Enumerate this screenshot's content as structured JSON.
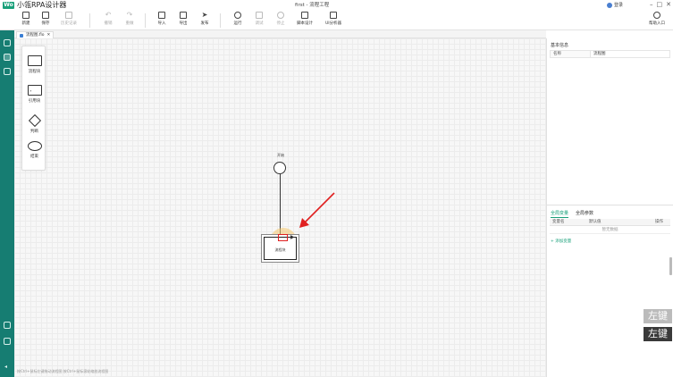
{
  "app": {
    "logo": "Wo",
    "title": "小瓴RPA设计器"
  },
  "window": {
    "doc_title": "first - 流程工程",
    "login": "登录",
    "min": "–",
    "max": "□",
    "close": "✕"
  },
  "toolbar": [
    {
      "label": "新建",
      "icon": "new-icon",
      "disabled": false
    },
    {
      "label": "保存",
      "icon": "save-icon",
      "disabled": false
    },
    {
      "label": "历史记录",
      "icon": "history-icon",
      "disabled": true
    },
    {
      "label": "撤销",
      "icon": "undo-icon",
      "disabled": true
    },
    {
      "label": "重做",
      "icon": "redo-icon",
      "disabled": true
    },
    {
      "label": "导入",
      "icon": "import-icon",
      "disabled": false
    },
    {
      "label": "导出",
      "icon": "export-icon",
      "disabled": false
    },
    {
      "label": "发布",
      "icon": "publish-icon",
      "disabled": false
    },
    {
      "label": "运行",
      "icon": "run-icon",
      "disabled": false
    },
    {
      "label": "调试",
      "icon": "debug-icon",
      "disabled": true
    },
    {
      "label": "停止",
      "icon": "stop-icon",
      "disabled": true
    },
    {
      "label": "脚本设计",
      "icon": "script-icon",
      "disabled": false
    },
    {
      "label": "UI分析器",
      "icon": "ui-analyzer-icon",
      "disabled": false
    },
    {
      "label": "帮助入口",
      "icon": "help-icon",
      "disabled": false
    }
  ],
  "tab": {
    "label": "流程图.flo",
    "close": "✕"
  },
  "palette": [
    {
      "label": "流程块",
      "shape": "rect"
    },
    {
      "label": "引用块",
      "shape": "ref"
    },
    {
      "label": "判断",
      "shape": "diamond"
    },
    {
      "label": "结束",
      "shape": "ellipse"
    }
  ],
  "canvas": {
    "start_label": "开始",
    "block_label": "流程块",
    "hint": "按Ctrl+鼠标左键拖动流程图 按Ctrl+鼠标滚轮缩放流程图"
  },
  "properties": {
    "title": "基本信息",
    "rows": [
      {
        "key": "名称",
        "value": "流程图"
      }
    ]
  },
  "variables": {
    "tabs": [
      "全局变量",
      "全局参数"
    ],
    "active_tab": 0,
    "columns": [
      "变量名",
      "默认值",
      "操作"
    ],
    "empty_text": "暂无数据",
    "add_label": "+ 添加变量"
  },
  "overlay_keys": [
    "左键",
    "左键"
  ],
  "colors": {
    "brand": "#1aa07a",
    "rail": "#167d72",
    "highlight": "#f5c86e",
    "marker": "#e02020"
  }
}
